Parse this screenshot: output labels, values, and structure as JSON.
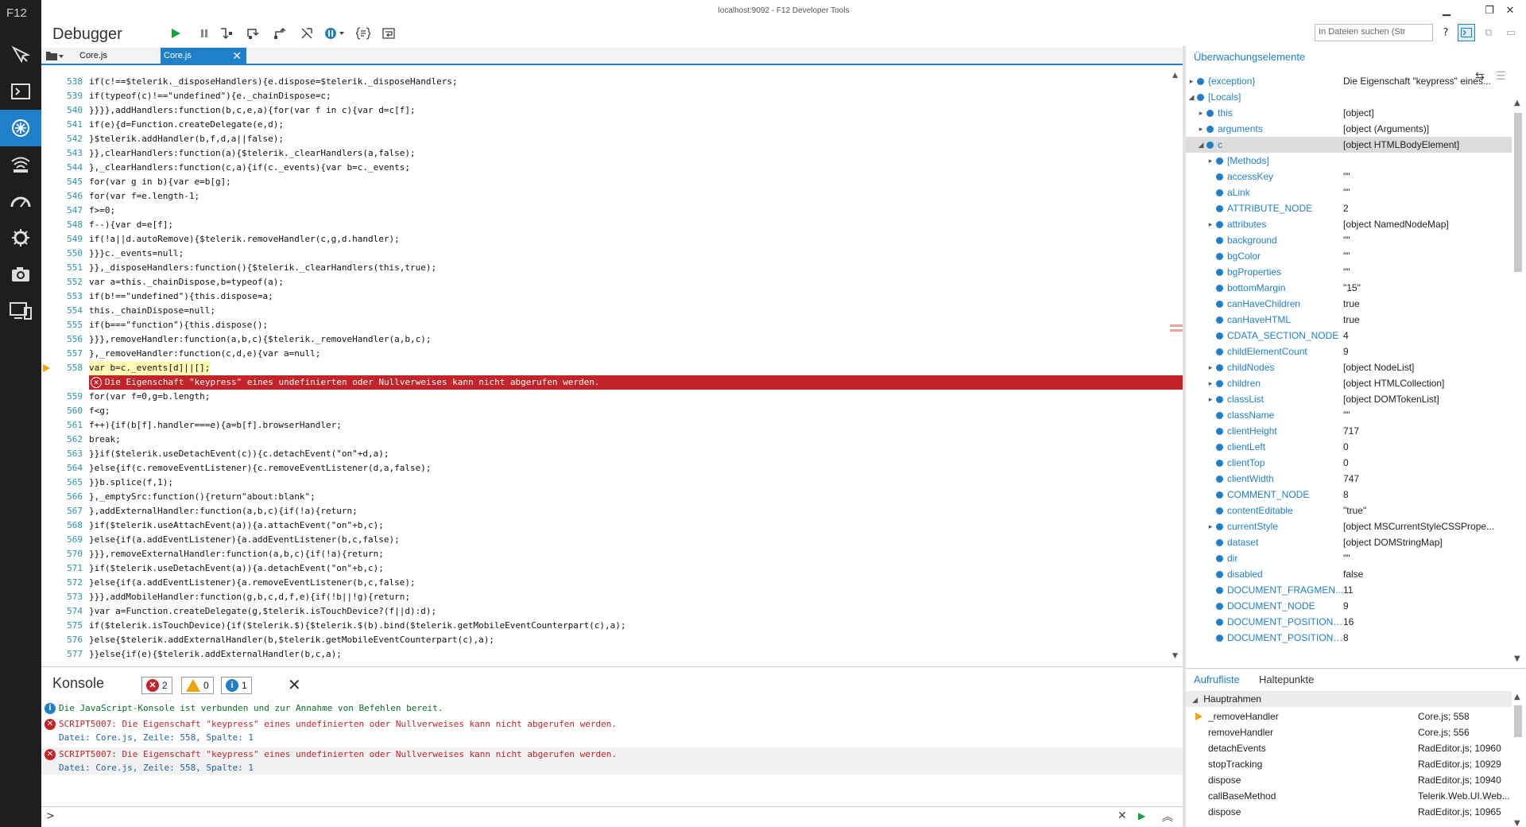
{
  "window": {
    "title": "localhost:9092 - F12 Developer Tools",
    "f12_label": "F12"
  },
  "sidebar": {
    "items": [
      {
        "icon": "dom-explorer-icon"
      },
      {
        "icon": "console-icon"
      },
      {
        "icon": "debugger-icon",
        "active": true
      },
      {
        "icon": "network-icon"
      },
      {
        "icon": "performance-icon"
      },
      {
        "icon": "memory-icon"
      },
      {
        "icon": "emulation-icon"
      },
      {
        "icon": "screen-icon"
      }
    ]
  },
  "toolbar": {
    "title": "Debugger",
    "search_placeholder": "In Dateien suchen (Str",
    "help": "?"
  },
  "tabs": {
    "file_picker_label": "Core.js",
    "active_tab": "Core.js",
    "close": "✕"
  },
  "code": {
    "lines_before": [
      {
        "n": "538",
        "t": "if(c!==$telerik._disposeHandlers){e.dispose=$telerik._disposeHandlers;"
      },
      {
        "n": "539",
        "t": "if(typeof(c)!==\"undefined\"){e._chainDispose=c;"
      },
      {
        "n": "540",
        "t": "}}}},addHandlers:function(b,c,e,a){for(var f in c){var d=c[f];"
      },
      {
        "n": "541",
        "t": "if(e){d=Function.createDelegate(e,d);"
      },
      {
        "n": "542",
        "t": "}$telerik.addHandler(b,f,d,a||false);"
      },
      {
        "n": "543",
        "t": "}},clearHandlers:function(a){$telerik._clearHandlers(a,false);"
      },
      {
        "n": "544",
        "t": "},_clearHandlers:function(c,a){if(c._events){var b=c._events;"
      },
      {
        "n": "545",
        "t": "for(var g in b){var e=b[g];"
      },
      {
        "n": "546",
        "t": "for(var f=e.length-1;"
      },
      {
        "n": "547",
        "t": "f>=0;"
      },
      {
        "n": "548",
        "t": "f--){var d=e[f];"
      },
      {
        "n": "549",
        "t": "if(!a||d.autoRemove){$telerik.removeHandler(c,g,d.handler);"
      },
      {
        "n": "550",
        "t": "}}}c._events=null;"
      },
      {
        "n": "551",
        "t": "}},_disposeHandlers:function(){$telerik._clearHandlers(this,true);"
      },
      {
        "n": "552",
        "t": "var a=this._chainDispose,b=typeof(a);"
      },
      {
        "n": "553",
        "t": "if(b!==\"undefined\"){this.dispose=a;"
      },
      {
        "n": "554",
        "t": "this._chainDispose=null;"
      },
      {
        "n": "555",
        "t": "if(b===\"function\"){this.dispose();"
      },
      {
        "n": "556",
        "t": "}}},removeHandler:function(a,b,c){$telerik._removeHandler(a,b,c);"
      },
      {
        "n": "557",
        "t": "},_removeHandler:function(c,d,e){var a=null;"
      },
      {
        "n": "558",
        "t": "var b=c._events[d]||[];"
      }
    ],
    "error_message": "Die Eigenschaft \"keypress\" eines undefinierten oder Nullverweises kann nicht abgerufen werden.",
    "lines_after": [
      {
        "n": "559",
        "t": "for(var f=0,g=b.length;"
      },
      {
        "n": "560",
        "t": "f<g;"
      },
      {
        "n": "561",
        "t": "f++){if(b[f].handler===e){a=b[f].browserHandler;"
      },
      {
        "n": "562",
        "t": "break;"
      },
      {
        "n": "563",
        "t": "}}if($telerik.useDetachEvent(c)){c.detachEvent(\"on\"+d,a);"
      },
      {
        "n": "564",
        "t": "}else{if(c.removeEventListener){c.removeEventListener(d,a,false);"
      },
      {
        "n": "565",
        "t": "}}b.splice(f,1);"
      },
      {
        "n": "566",
        "t": "},_emptySrc:function(){return\"about:blank\";"
      },
      {
        "n": "567",
        "t": "},addExternalHandler:function(a,b,c){if(!a){return;"
      },
      {
        "n": "568",
        "t": "}if($telerik.useAttachEvent(a)){a.attachEvent(\"on\"+b,c);"
      },
      {
        "n": "569",
        "t": "}else{if(a.addEventListener){a.addEventListener(b,c,false);"
      },
      {
        "n": "570",
        "t": "}}},removeExternalHandler:function(a,b,c){if(!a){return;"
      },
      {
        "n": "571",
        "t": "}if($telerik.useDetachEvent(a)){a.detachEvent(\"on\"+b,c);"
      },
      {
        "n": "572",
        "t": "}else{if(a.addEventListener){a.removeEventListener(b,c,false);"
      },
      {
        "n": "573",
        "t": "}}},addMobileHandler:function(g,b,c,d,f,e){if(!b||!g){return;"
      },
      {
        "n": "574",
        "t": "}var a=Function.createDelegate(g,$telerik.isTouchDevice?(f||d):d);"
      },
      {
        "n": "575",
        "t": "if($telerik.isTouchDevice){if($telerik.$){$telerik.$(b).bind($telerik.getMobileEventCounterpart(c),a);"
      },
      {
        "n": "576",
        "t": "}else{$telerik.addExternalHandler(b,$telerik.getMobileEventCounterpart(c),a);"
      },
      {
        "n": "577",
        "t": "}}else{if(e){$telerik.addExternalHandler(b,c,a);"
      }
    ]
  },
  "console": {
    "title": "Konsole",
    "error_count": "2",
    "warning_count": "0",
    "info_count": "1",
    "messages": [
      {
        "type": "info",
        "text": "Die JavaScript-Konsole ist verbunden und zur Annahme von Befehlen bereit."
      },
      {
        "type": "error",
        "text": "SCRIPT5007: Die Eigenschaft \"keypress\" eines undefinierten oder Nullverweises kann nicht abgerufen werden.",
        "detail": "Datei: Core.js, Zeile: 558, Spalte: 1"
      },
      {
        "type": "error",
        "text": "SCRIPT5007: Die Eigenschaft \"keypress\" eines undefinierten oder Nullverweises kann nicht abgerufen werden.",
        "detail": "Datei: Core.js, Zeile: 558, Spalte: 1"
      }
    ],
    "prompt": ">"
  },
  "watch": {
    "title": "Überwachungselemente",
    "rows": [
      {
        "name": "{exception}",
        "value": "Die Eigenschaft \"keypress\" eines...",
        "expand": "▸",
        "depth": 0
      },
      {
        "name": "[Locals]",
        "value": "",
        "expand": "◢",
        "depth": 0
      },
      {
        "name": "this",
        "value": "[object]",
        "expand": "▸",
        "depth": 1
      },
      {
        "name": "arguments",
        "value": "[object (Arguments)]",
        "expand": "▸",
        "depth": 1
      },
      {
        "name": "c",
        "value": "[object HTMLBodyElement]",
        "expand": "◢",
        "depth": 1
      },
      {
        "name": "[Methods]",
        "value": "",
        "expand": "▸",
        "depth": 2
      },
      {
        "name": "accessKey",
        "value": "\"\"",
        "expand": "",
        "depth": 2
      },
      {
        "name": "aLink",
        "value": "\"\"",
        "expand": "",
        "depth": 2
      },
      {
        "name": "ATTRIBUTE_NODE",
        "value": "2",
        "expand": "",
        "depth": 2
      },
      {
        "name": "attributes",
        "value": "[object NamedNodeMap]",
        "expand": "▸",
        "depth": 2
      },
      {
        "name": "background",
        "value": "\"\"",
        "expand": "",
        "depth": 2
      },
      {
        "name": "bgColor",
        "value": "\"\"",
        "expand": "",
        "depth": 2
      },
      {
        "name": "bgProperties",
        "value": "\"\"",
        "expand": "",
        "depth": 2
      },
      {
        "name": "bottomMargin",
        "value": "\"15\"",
        "expand": "",
        "depth": 2
      },
      {
        "name": "canHaveChildren",
        "value": "true",
        "expand": "",
        "depth": 2
      },
      {
        "name": "canHaveHTML",
        "value": "true",
        "expand": "",
        "depth": 2
      },
      {
        "name": "CDATA_SECTION_NODE",
        "value": "4",
        "expand": "",
        "depth": 2
      },
      {
        "name": "childElementCount",
        "value": "9",
        "expand": "",
        "depth": 2
      },
      {
        "name": "childNodes",
        "value": "[object NodeList]",
        "expand": "▸",
        "depth": 2
      },
      {
        "name": "children",
        "value": "[object HTMLCollection]",
        "expand": "▸",
        "depth": 2
      },
      {
        "name": "classList",
        "value": "[object DOMTokenList]",
        "expand": "▸",
        "depth": 2
      },
      {
        "name": "className",
        "value": "\"\"",
        "expand": "",
        "depth": 2
      },
      {
        "name": "clientHeight",
        "value": "717",
        "expand": "",
        "depth": 2
      },
      {
        "name": "clientLeft",
        "value": "0",
        "expand": "",
        "depth": 2
      },
      {
        "name": "clientTop",
        "value": "0",
        "expand": "",
        "depth": 2
      },
      {
        "name": "clientWidth",
        "value": "747",
        "expand": "",
        "depth": 2
      },
      {
        "name": "COMMENT_NODE",
        "value": "8",
        "expand": "",
        "depth": 2
      },
      {
        "name": "contentEditable",
        "value": "\"true\"",
        "expand": "",
        "depth": 2
      },
      {
        "name": "currentStyle",
        "value": "[object MSCurrentStyleCSSPrope...",
        "expand": "▸",
        "depth": 2
      },
      {
        "name": "dataset",
        "value": "[object DOMStringMap]",
        "expand": "",
        "depth": 2
      },
      {
        "name": "dir",
        "value": "\"\"",
        "expand": "",
        "depth": 2
      },
      {
        "name": "disabled",
        "value": "false",
        "expand": "",
        "depth": 2
      },
      {
        "name": "DOCUMENT_FRAGMEN...",
        "value": "11",
        "expand": "",
        "depth": 2
      },
      {
        "name": "DOCUMENT_NODE",
        "value": "9",
        "expand": "",
        "depth": 2
      },
      {
        "name": "DOCUMENT_POSITION_...",
        "value": "16",
        "expand": "",
        "depth": 2
      },
      {
        "name": "DOCUMENT_POSITION_...",
        "value": "8",
        "expand": "",
        "depth": 2
      }
    ]
  },
  "callstack": {
    "tabs": [
      "Aufrufliste",
      "Haltepunkte"
    ],
    "group": "Hauptrahmen",
    "rows": [
      {
        "fn": "_removeHandler",
        "loc": "Core.js; 558",
        "current": true
      },
      {
        "fn": "removeHandler",
        "loc": "Core.js; 556"
      },
      {
        "fn": "detachEvents",
        "loc": "RadEditor.js; 10960"
      },
      {
        "fn": "stopTracking",
        "loc": "RadEditor.js; 10929"
      },
      {
        "fn": "dispose",
        "loc": "RadEditor.js; 10940"
      },
      {
        "fn": "callBaseMethod",
        "loc": "Telerik.Web.UI.Web..."
      },
      {
        "fn": "dispose",
        "loc": "RadEditor.js; 10965"
      }
    ]
  },
  "colors": {
    "accent": "#1f7fc8",
    "error": "#c5232a",
    "sidebar": "#1e1e1e",
    "warning": "#f0a30a"
  }
}
